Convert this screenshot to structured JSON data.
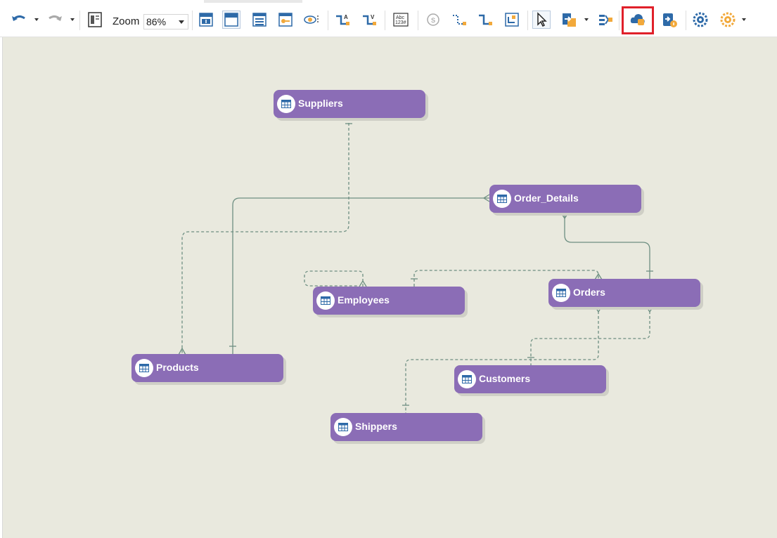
{
  "toolbar": {
    "zoom_label": "Zoom",
    "zoom_value": "86%",
    "buttons": [
      {
        "name": "undo-button"
      },
      {
        "name": "redo-button"
      },
      {
        "name": "page-layout-button"
      },
      {
        "name": "show-primary-key-button"
      },
      {
        "name": "show-title-only-button"
      },
      {
        "name": "show-all-fields-button"
      },
      {
        "name": "show-key-fields-button"
      },
      {
        "name": "show-hide-relations-button"
      },
      {
        "name": "one-to-many-relation-button"
      },
      {
        "name": "many-to-one-relation-button"
      },
      {
        "name": "abc-text-button"
      },
      {
        "name": "reset-button"
      },
      {
        "name": "dashed-relation-button"
      },
      {
        "name": "solid-relation-button"
      },
      {
        "name": "fit-window-button"
      },
      {
        "name": "select-pointer-button"
      },
      {
        "name": "export-button"
      },
      {
        "name": "align-button"
      },
      {
        "name": "cloud-sync-button"
      },
      {
        "name": "database-info-button"
      },
      {
        "name": "refresh-button"
      },
      {
        "name": "settings-button"
      }
    ]
  },
  "annotation": {
    "highlight_color": "#e0202a",
    "target": "cloud-sync-button"
  },
  "diagram": {
    "entity_color": "#8b6db6",
    "canvas_color": "#e9e9de",
    "entities": [
      {
        "key": "suppliers",
        "label": "Suppliers"
      },
      {
        "key": "order_details",
        "label": "Order_Details"
      },
      {
        "key": "employees",
        "label": "Employees"
      },
      {
        "key": "orders",
        "label": "Orders"
      },
      {
        "key": "products",
        "label": "Products"
      },
      {
        "key": "customers",
        "label": "Customers"
      },
      {
        "key": "shippers",
        "label": "Shippers"
      }
    ]
  }
}
